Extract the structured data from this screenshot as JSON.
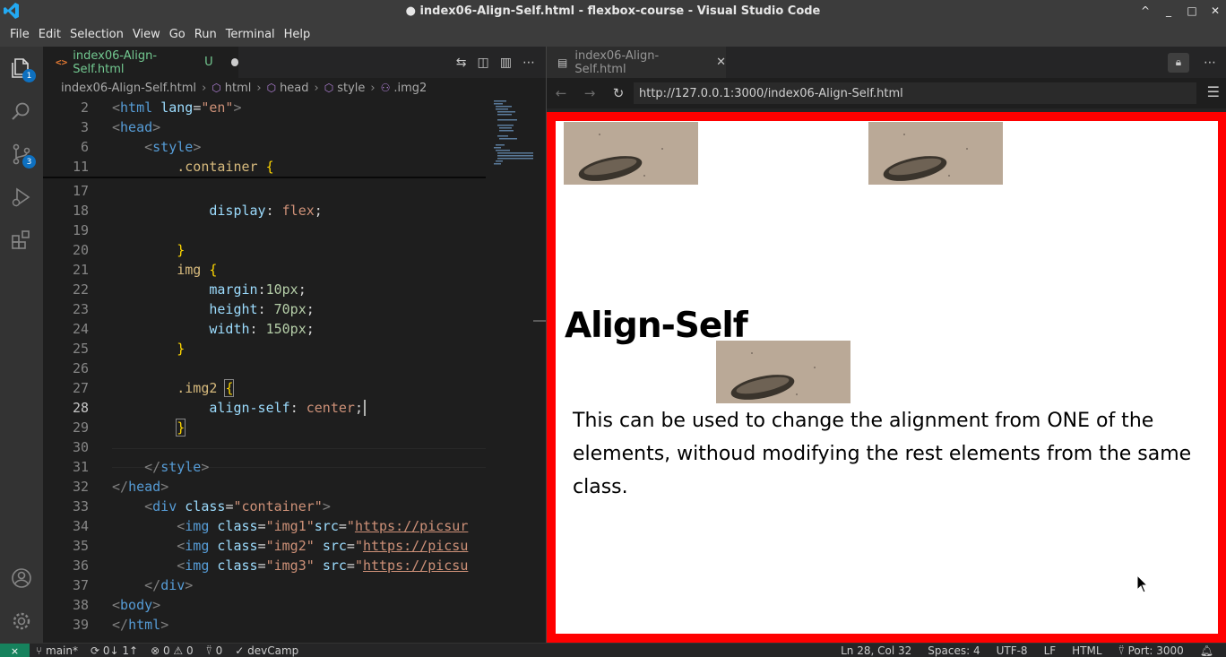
{
  "window": {
    "title": "● index06-Align-Self.html - flexbox-course - Visual Studio Code",
    "controls": [
      "^",
      "_",
      "□",
      "✕"
    ]
  },
  "menu": [
    "File",
    "Edit",
    "Selection",
    "View",
    "Go",
    "Run",
    "Terminal",
    "Help"
  ],
  "activity": {
    "explorer_badge": "1",
    "scm_badge": "3",
    "icons": [
      "files-icon",
      "search-icon",
      "source-control-icon",
      "run-debug-icon",
      "extensions-icon",
      "account-icon",
      "settings-gear-icon"
    ]
  },
  "editor": {
    "tab_icon": "<>",
    "tab_label": "index06-Align-Self.html",
    "tab_status": "U",
    "breadcrumb": [
      "index06-Align-Self.html",
      "html",
      "head",
      "style",
      ".img2"
    ],
    "lines": [
      {
        "num": "2",
        "html": "&lt;html lang=\"en\"&gt;"
      },
      {
        "num": "3"
      },
      {
        "num": "6"
      },
      {
        "num": "11"
      },
      {
        "num": "17"
      },
      {
        "num": "18"
      },
      {
        "num": "19"
      },
      {
        "num": "20"
      },
      {
        "num": "21"
      },
      {
        "num": "22"
      },
      {
        "num": "23"
      },
      {
        "num": "24"
      },
      {
        "num": "25"
      },
      {
        "num": "26"
      },
      {
        "num": "27"
      },
      {
        "num": "28"
      },
      {
        "num": "29"
      },
      {
        "num": "30"
      },
      {
        "num": "31"
      },
      {
        "num": "32"
      },
      {
        "num": "33"
      },
      {
        "num": "34"
      },
      {
        "num": "35"
      },
      {
        "num": "36"
      },
      {
        "num": "37"
      },
      {
        "num": "38"
      },
      {
        "num": "39"
      }
    ],
    "code": {
      "l2_tag": "html",
      "l2_attr": "lang",
      "l2_val": "\"en\"",
      "l3_tag": "head",
      "l6_tag": "style",
      "l11_sel": ".container",
      "l18_prop": "display",
      "l18_val": "flex",
      "l21_sel": "img",
      "l22_prop": "margin",
      "l22_val": "10px",
      "l23_prop": "height",
      "l23_val": "70px",
      "l24_prop": "width",
      "l24_val": "150px",
      "l27_sel": ".img2",
      "l28_prop": "align-self",
      "l28_val": "center",
      "l31_tag": "style",
      "l32_tag": "head",
      "l33_tag": "div",
      "l33_attr": "class",
      "l33_val": "\"container\"",
      "l34_tag": "img",
      "l34_attr": "class",
      "l34_val": "\"img1\"",
      "l34_attr2": "src",
      "l34_url": "https://picsur",
      "l35_tag": "img",
      "l35_attr": "class",
      "l35_val": "\"img2\"",
      "l35_attr2": "src",
      "l35_url": "https://picsu",
      "l36_tag": "img",
      "l36_attr": "class",
      "l36_val": "\"img3\"",
      "l36_attr2": "src",
      "l36_url": "https://picsu",
      "l37_tag": "div",
      "l38_tag": "body",
      "l39_tag": "html"
    }
  },
  "browser": {
    "tab_label": "index06-Align-Self.html",
    "url": "http://127.0.0.1:3000/index06-Align-Self.html",
    "page": {
      "heading": "Align-Self",
      "paragraph": "This can be used to change the alignment from ONE of the elements, withoud modifying the rest elements from the same class."
    }
  },
  "status": {
    "branch": "main*",
    "sync": "0↓ 1↑",
    "problems": "⊗ 0 ⚠ 0",
    "ports": "0",
    "devcamp": "devCamp",
    "position": "Ln 28, Col 32",
    "spaces": "Spaces: 4",
    "encoding": "UTF-8",
    "eol": "LF",
    "language": "HTML",
    "port": "Port: 3000"
  },
  "colors": {
    "accent": "#0e70c0",
    "remote": "#16825d",
    "page_border": "#ff0000"
  }
}
